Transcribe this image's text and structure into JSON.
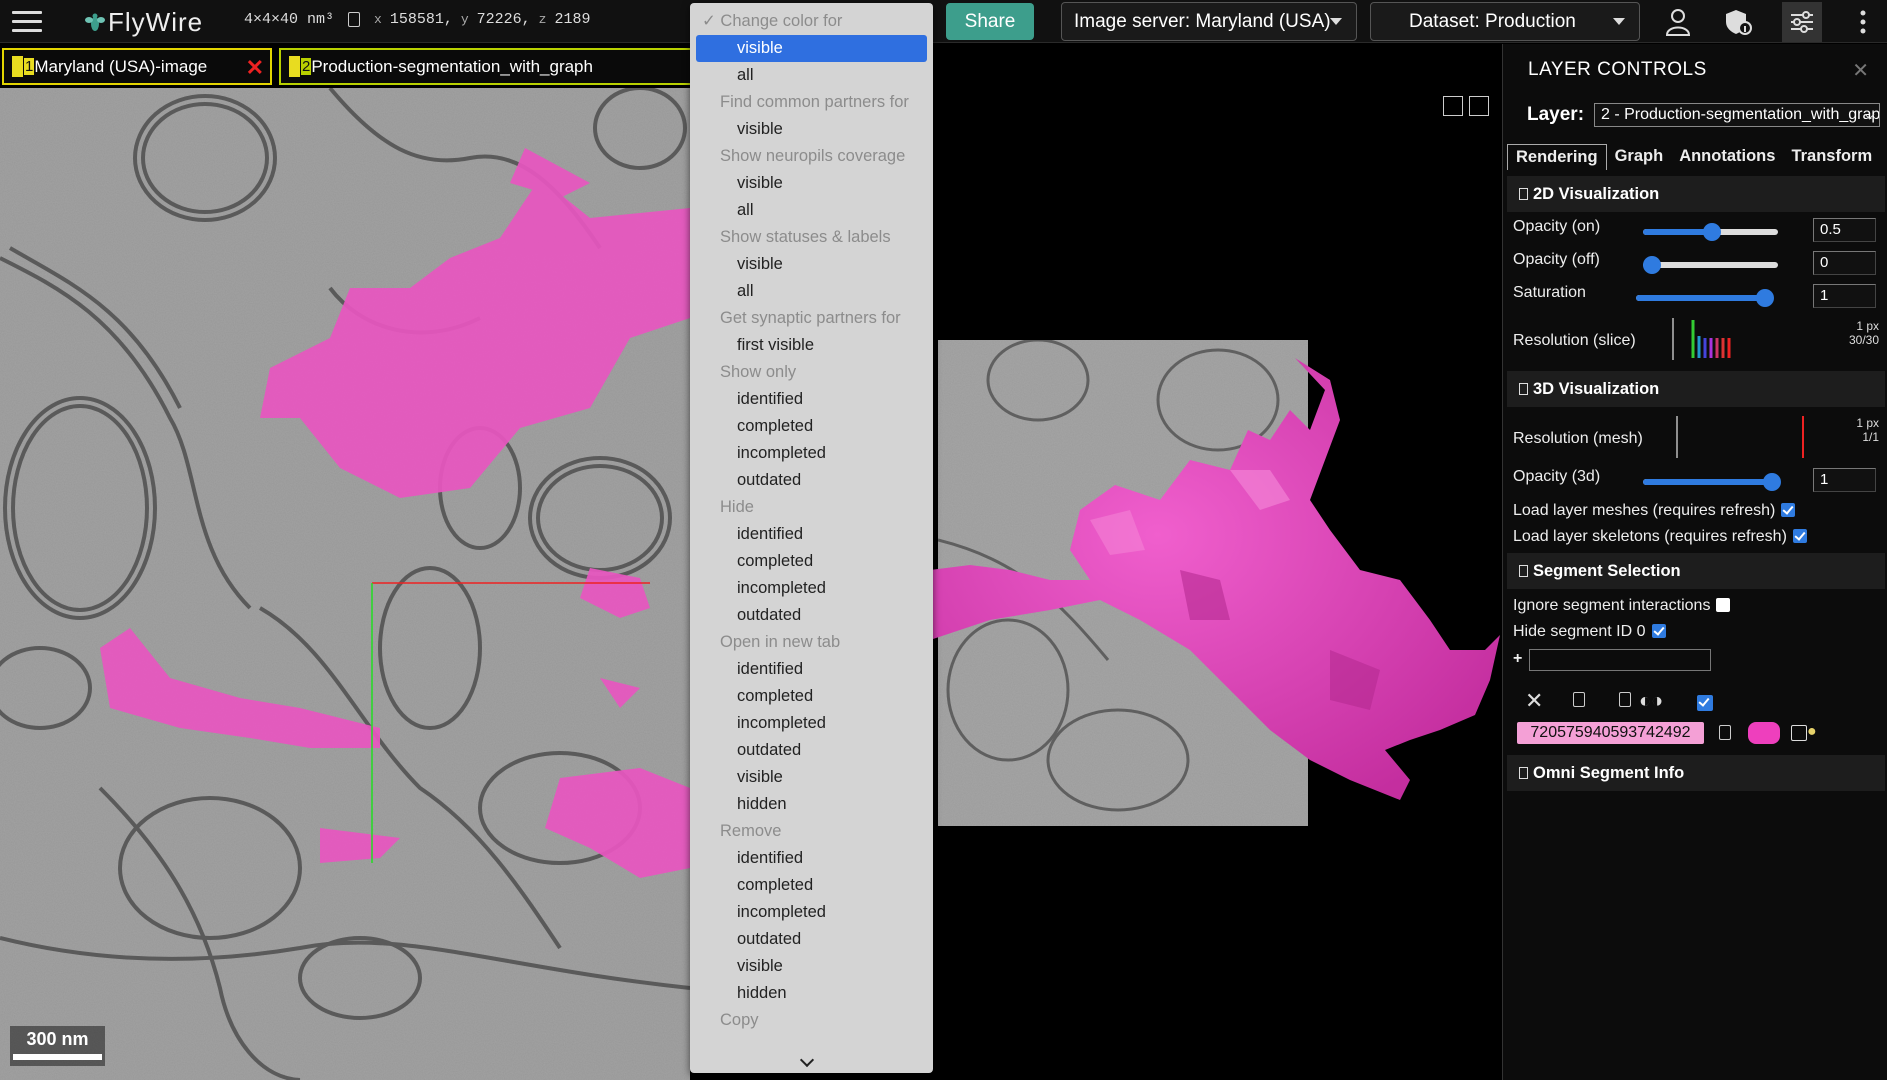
{
  "topbar": {
    "app_name": "FlyWire",
    "voxel_size": "4×4×40 nm³",
    "x_label": "x",
    "x_value": "158581,",
    "y_label": "y",
    "y_value": "72226,",
    "z_label": "z",
    "z_value": "2189",
    "share_label": "Share",
    "image_server": "Image server: Maryland (USA)",
    "dataset": "Dataset: Production"
  },
  "tabs": [
    {
      "number": "1",
      "label": "Maryland (USA)-image"
    },
    {
      "number": "2",
      "label": "Production-segmentation_with_graph"
    }
  ],
  "scale_bar": "300 nm",
  "context_menu": {
    "items": [
      {
        "kind": "header",
        "label": "Change color for",
        "checked": true
      },
      {
        "kind": "item",
        "label": "visible",
        "selected": true
      },
      {
        "kind": "item",
        "label": "all"
      },
      {
        "kind": "header",
        "label": "Find common partners for"
      },
      {
        "kind": "item",
        "label": "visible"
      },
      {
        "kind": "header",
        "label": "Show neuropils coverage"
      },
      {
        "kind": "item",
        "label": "visible"
      },
      {
        "kind": "item",
        "label": "all"
      },
      {
        "kind": "header",
        "label": "Show statuses & labels"
      },
      {
        "kind": "item",
        "label": "visible"
      },
      {
        "kind": "item",
        "label": "all"
      },
      {
        "kind": "header",
        "label": "Get synaptic partners for"
      },
      {
        "kind": "item",
        "label": "first visible"
      },
      {
        "kind": "header",
        "label": "Show only"
      },
      {
        "kind": "item",
        "label": "identified"
      },
      {
        "kind": "item",
        "label": "completed"
      },
      {
        "kind": "item",
        "label": "incompleted"
      },
      {
        "kind": "item",
        "label": "outdated"
      },
      {
        "kind": "header",
        "label": "Hide"
      },
      {
        "kind": "item",
        "label": "identified"
      },
      {
        "kind": "item",
        "label": "completed"
      },
      {
        "kind": "item",
        "label": "incompleted"
      },
      {
        "kind": "item",
        "label": "outdated"
      },
      {
        "kind": "header",
        "label": "Open in new tab"
      },
      {
        "kind": "item",
        "label": "identified"
      },
      {
        "kind": "item",
        "label": "completed"
      },
      {
        "kind": "item",
        "label": "incompleted"
      },
      {
        "kind": "item",
        "label": "outdated"
      },
      {
        "kind": "item",
        "label": "visible"
      },
      {
        "kind": "item",
        "label": "hidden"
      },
      {
        "kind": "header",
        "label": "Remove"
      },
      {
        "kind": "item",
        "label": "identified"
      },
      {
        "kind": "item",
        "label": "completed"
      },
      {
        "kind": "item",
        "label": "incompleted"
      },
      {
        "kind": "item",
        "label": "outdated"
      },
      {
        "kind": "item",
        "label": "visible"
      },
      {
        "kind": "item",
        "label": "hidden"
      },
      {
        "kind": "header",
        "label": "Copy"
      }
    ]
  },
  "layer_controls": {
    "title": "LAYER CONTROLS",
    "layer_label": "Layer:",
    "layer_value": "2 - Production-segmentation_with_graph",
    "tabs": [
      "Rendering",
      "Graph",
      "Annotations",
      "Transform"
    ],
    "viz2d": {
      "title": "2D Visualization",
      "opacity_on_label": "Opacity (on)",
      "opacity_on": "0.5",
      "opacity_off_label": "Opacity (off)",
      "opacity_off": "0",
      "saturation_label": "Saturation",
      "saturation": "1",
      "resolution_label": "Resolution (slice)",
      "resolution_px": "1 px",
      "resolution_ratio": "30/30"
    },
    "viz3d": {
      "title": "3D Visualization",
      "resolution_label": "Resolution (mesh)",
      "resolution_px": "1 px",
      "resolution_ratio": "1/1",
      "opacity_label": "Opacity (3d)",
      "opacity": "1",
      "load_meshes": "Load layer meshes (requires refresh)",
      "load_skeletons": "Load layer skeletons (requires refresh)"
    },
    "segment_selection": {
      "title": "Segment Selection",
      "ignore_label": "Ignore segment interactions",
      "hide_label": "Hide segment ID 0",
      "add_symbol": "+",
      "segment_id": "720575940593742492",
      "segment_color": "#ee3fbd"
    },
    "omni": {
      "title": "Omni Segment Info"
    }
  }
}
